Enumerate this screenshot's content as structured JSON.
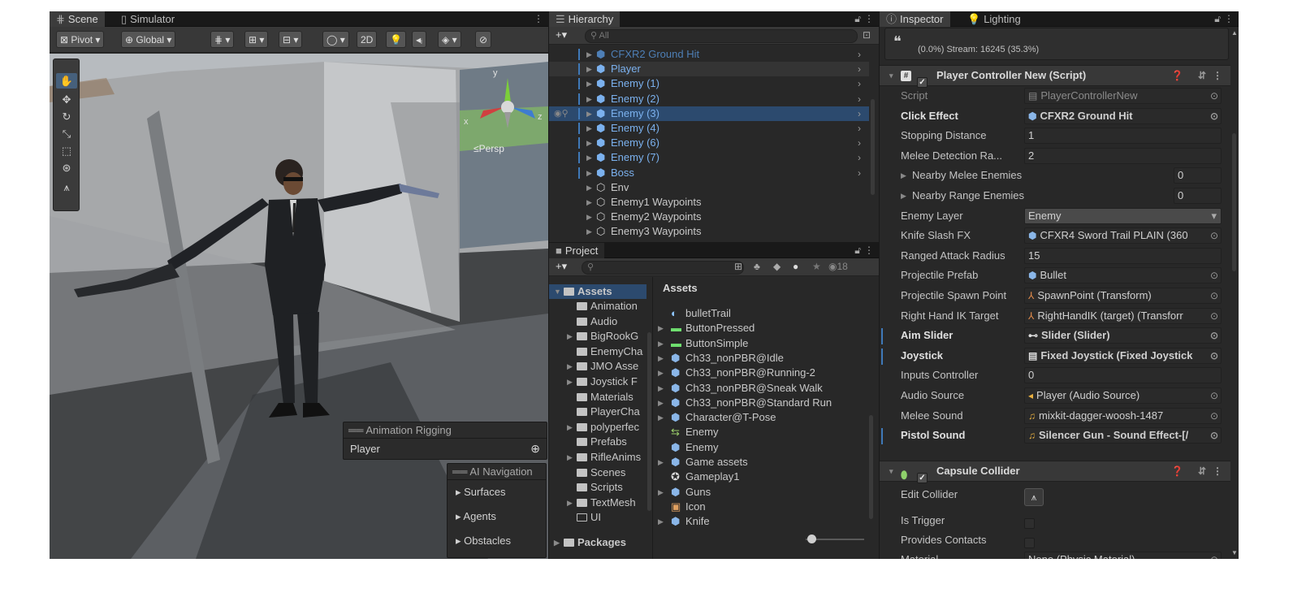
{
  "scene": {
    "tabs": [
      "Scene",
      "Simulator"
    ],
    "toolbar": {
      "pivot": "Pivot",
      "global": "Global",
      "mode2d": "2D"
    },
    "persp_label": "Persp",
    "gizmo": {
      "y": "y",
      "x": "x",
      "z": "z"
    },
    "rigging": {
      "title": "Animation Rigging",
      "value": "Player"
    },
    "ai_nav": {
      "title": "AI Navigation",
      "items": [
        "Surfaces",
        "Agents",
        "Obstacles"
      ]
    }
  },
  "hierarchy": {
    "title": "Hierarchy",
    "search_placeholder": "All",
    "rows": [
      "CFXR2 Ground Hit",
      "Player",
      "Enemy (1)",
      "Enemy (2)",
      "Enemy (3)",
      "Enemy (4)",
      "Enemy (6)",
      "Enemy (7)",
      "Boss",
      "Env",
      "Enemy1 Waypoints",
      "Enemy2 Waypoints",
      "Enemy3 Waypoints"
    ]
  },
  "project": {
    "title": "Project",
    "visibility_count": "18",
    "tree": {
      "root": "Assets",
      "children": [
        "Animation",
        "Audio",
        "BigRookG",
        "EnemyCha",
        "JMO Asse",
        "Joystick F",
        "Materials",
        "PlayerCha",
        "polyperfec",
        "Prefabs",
        "RifleAnims",
        "Scenes",
        "Scripts",
        "TextMesh",
        "UI"
      ],
      "packages": "Packages"
    },
    "assets_header": "Assets",
    "files": [
      "bulletTrail",
      "ButtonPressed",
      "ButtonSimple",
      "Ch33_nonPBR@Idle",
      "Ch33_nonPBR@Running-2",
      "Ch33_nonPBR@Sneak Walk",
      "Ch33_nonPBR@Standard Run",
      "Character@T-Pose",
      "Enemy",
      "Enemy",
      "Game assets",
      "Gameplay1",
      "Guns",
      "Icon",
      "Knife"
    ]
  },
  "inspector": {
    "tabs": [
      "Inspector",
      "Lighting"
    ],
    "top_info": "(0.0%) Stream: 16245 (35.3%)",
    "component1": {
      "title": "Player Controller New (Script)",
      "script_label": "Script",
      "script_value": "PlayerControllerNew",
      "fields": [
        {
          "label": "Click Effect",
          "value": "CFXR2 Ground Hit"
        },
        {
          "label": "Stopping Distance",
          "value": "1"
        },
        {
          "label": "Melee Detection Ra...",
          "value": "2"
        },
        {
          "label": "Nearby Melee Enemies",
          "value": "0"
        },
        {
          "label": "Nearby Range Enemies",
          "value": "0"
        },
        {
          "label": "Enemy Layer",
          "value": "Enemy"
        },
        {
          "label": "Knife Slash FX",
          "value": "CFXR4 Sword Trail PLAIN (360"
        },
        {
          "label": "Ranged Attack Radius",
          "value": "15"
        },
        {
          "label": "Projectile Prefab",
          "value": "Bullet"
        },
        {
          "label": "Projectile Spawn Point",
          "value": "SpawnPoint (Transform)"
        },
        {
          "label": "Right Hand IK Target",
          "value": "RightHandIK (target) (Transforr"
        },
        {
          "label": "Aim Slider",
          "value": "Slider (Slider)"
        },
        {
          "label": "Joystick",
          "value": "Fixed Joystick (Fixed Joystick"
        },
        {
          "label": "Inputs Controller",
          "value": "0"
        },
        {
          "label": "Audio Source",
          "value": "Player (Audio Source)"
        },
        {
          "label": "Melee Sound",
          "value": "mixkit-dagger-woosh-1487"
        },
        {
          "label": "Pistol Sound",
          "value": "Silencer Gun - Sound Effect-[/"
        }
      ]
    },
    "component2": {
      "title": "Capsule Collider",
      "fields": [
        {
          "label": "Edit Collider"
        },
        {
          "label": "Is Trigger"
        },
        {
          "label": "Provides Contacts"
        },
        {
          "label": "Material",
          "value": "None (Physic Material)"
        }
      ]
    }
  },
  "colors": {
    "selection": "#2c4a6e",
    "accent_blue": "#7bb1ee",
    "panel_bg": "#282828"
  }
}
